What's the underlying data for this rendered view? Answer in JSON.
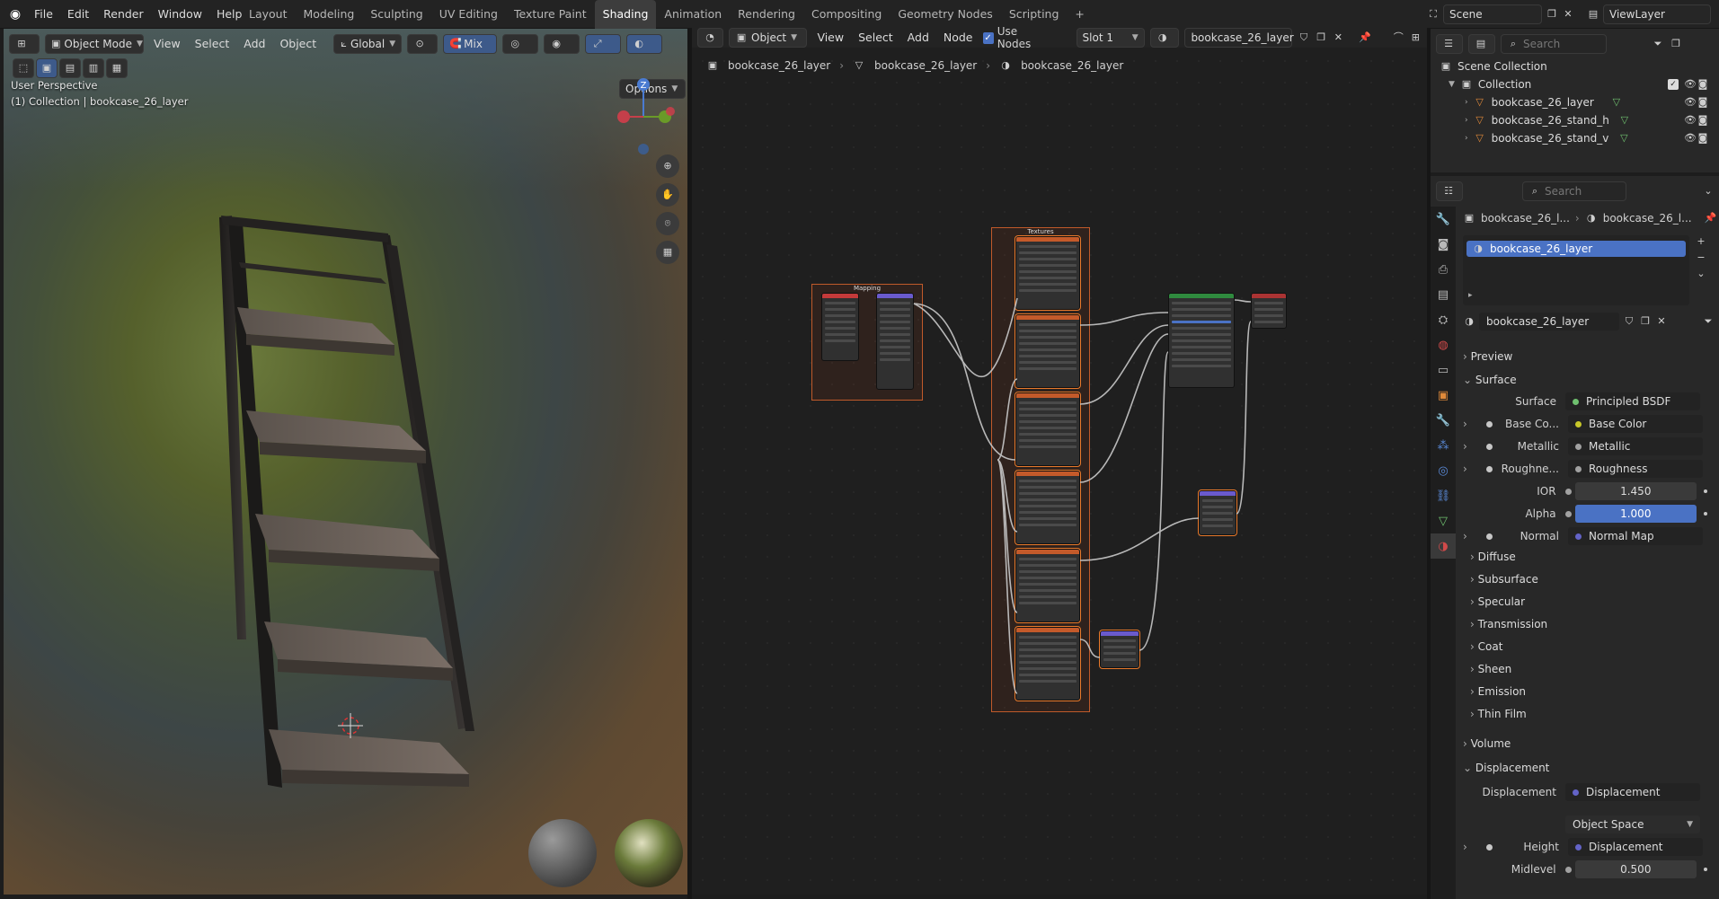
{
  "topbar": {
    "menus": [
      "File",
      "Edit",
      "Render",
      "Window",
      "Help"
    ],
    "workspaces": [
      "Layout",
      "Modeling",
      "Sculpting",
      "UV Editing",
      "Texture Paint",
      "Shading",
      "Animation",
      "Rendering",
      "Compositing",
      "Geometry Nodes",
      "Scripting"
    ],
    "active_workspace": "Shading",
    "add_tab": "+",
    "scene": "Scene",
    "view_layer": "ViewLayer"
  },
  "viewport": {
    "mode": "Object Mode",
    "menus": [
      "View",
      "Select",
      "Add",
      "Object"
    ],
    "transform": "Global",
    "mix": "Mix",
    "options": "Options",
    "perspective": "User Perspective",
    "collection_info": "(1) Collection | bookcase_26_layer",
    "gizmo_axis": "Z"
  },
  "node_editor": {
    "type": "Object",
    "menus": [
      "View",
      "Select",
      "Add",
      "Node"
    ],
    "use_nodes": "Use Nodes",
    "slot": "Slot 1",
    "material": "bookcase_26_layer",
    "breadcrumbs": [
      "bookcase_26_layer",
      "bookcase_26_layer",
      "bookcase_26_layer"
    ],
    "frames": {
      "mapping": "Mapping",
      "textures": "Textures"
    }
  },
  "outliner": {
    "search_placeholder": "Search",
    "scene_collection": "Scene Collection",
    "collection": "Collection",
    "objects": [
      "bookcase_26_layer",
      "bookcase_26_stand_h",
      "bookcase_26_stand_v"
    ]
  },
  "properties": {
    "search_placeholder": "Search",
    "breadcrumb_object": "bookcase_26_l...",
    "breadcrumb_material": "bookcase_26_l...",
    "material_slot": "bookcase_26_layer",
    "material_name": "bookcase_26_layer",
    "sections": {
      "preview": "Preview",
      "surface": "Surface",
      "diffuse": "Diffuse",
      "subsurface": "Subsurface",
      "specular": "Specular",
      "transmission": "Transmission",
      "coat": "Coat",
      "sheen": "Sheen",
      "emission": "Emission",
      "thin_film": "Thin Film",
      "volume": "Volume",
      "displacement": "Displacement"
    },
    "surface": {
      "surface_label": "Surface",
      "surface_value": "Principled BSDF",
      "base_color_label": "Base Co...",
      "base_color_value": "Base Color",
      "metallic_label": "Metallic",
      "metallic_value": "Metallic",
      "roughness_label": "Roughne...",
      "roughness_value": "Roughness",
      "ior_label": "IOR",
      "ior_value": "1.450",
      "alpha_label": "Alpha",
      "alpha_value": "1.000",
      "normal_label": "Normal",
      "normal_value": "Normal Map"
    },
    "displacement": {
      "disp_label": "Displacement",
      "disp_value": "Displacement",
      "space_value": "Object Space",
      "height_label": "Height",
      "height_value": "Displacement",
      "midlevel_label": "Midlevel",
      "midlevel_value": "0.500"
    }
  },
  "colors": {
    "accent_blue": "#4a72c4",
    "frame_orange": "#c05a2a",
    "socket_yellow": "#c7c729",
    "socket_gray": "#a1a1a1",
    "socket_purple": "#6363c7"
  }
}
